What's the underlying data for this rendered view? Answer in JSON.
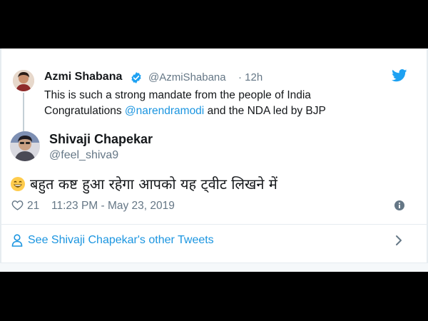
{
  "parent_tweet": {
    "display_name": "Azmi Shabana",
    "handle": "@AzmiShabana",
    "time": "· 12h",
    "text_line1": "This is such a strong mandate from the people of India",
    "text_line2_prefix": "Congratulations ",
    "mention": "@narendramodi",
    "text_line2_suffix": " and the NDA led by BJP",
    "avatar_icon": "profile-photo",
    "verified_icon": "verified-badge-icon"
  },
  "reply_tweet": {
    "display_name": "Shivaji Chapekar",
    "handle": "@feel_shiva9",
    "text": "बहुत कष्ट हुआ रहेगा आपको यह ट्वीट लिखने में",
    "emoji_icon": "grinning-face-icon",
    "likes": "21",
    "timestamp": "11:23 PM - May 23, 2019"
  },
  "footer": {
    "see_more_label": "See Shivaji Chapekar's other Tweets"
  },
  "colors": {
    "link_blue": "#1b95e0",
    "text_dark": "#14171a",
    "text_gray": "#657786",
    "twitter_blue": "#1da1f2"
  }
}
